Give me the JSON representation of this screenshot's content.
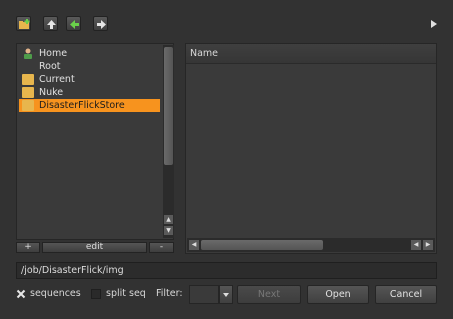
{
  "left_panel": {
    "items": [
      {
        "label": "Home",
        "icon": "home-icon"
      },
      {
        "label": "Root",
        "icon": "none"
      },
      {
        "label": "Current",
        "icon": "folder-icon"
      },
      {
        "label": "Nuke",
        "icon": "folder-icon"
      },
      {
        "label": "DisasterFlickStore",
        "icon": "folder-icon",
        "selected": true
      }
    ],
    "add_label": "+",
    "edit_label": "edit",
    "remove_label": "-"
  },
  "file_list": {
    "column_name": "Name"
  },
  "path": "/job/DisasterFlick/img",
  "options": {
    "sequences_label": "sequences",
    "sequences_checked": true,
    "split_seq_label": "split seq",
    "split_seq_checked": false,
    "filter_label": "Filter:",
    "filter_value": ""
  },
  "buttons": {
    "next": "Next",
    "open": "Open",
    "cancel": "Cancel"
  },
  "colors": {
    "selection": "#f7931e",
    "background": "#323232"
  }
}
